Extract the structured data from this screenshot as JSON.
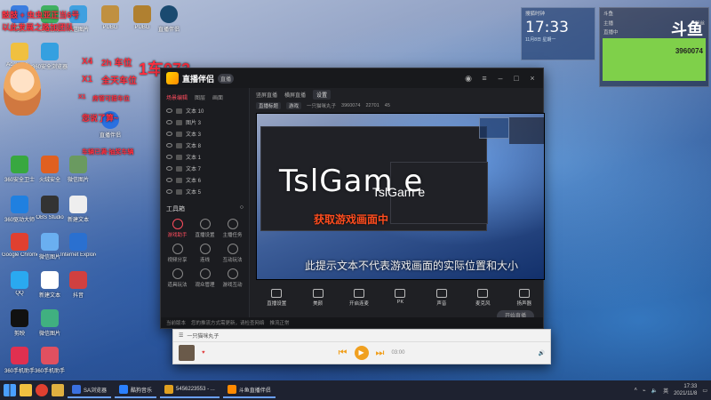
{
  "overlay": {
    "top_left_red_1": "鼓鼓 + 虫虫亚正当6号",
    "top_left_red_2": "以此发展之路加团队",
    "car_labels": [
      "X4",
      "2h 车位",
      "X1",
      "全天车位",
      "X1",
      "房管可接车位"
    ],
    "car_big": "1车073",
    "queue_msg": "您说了算~",
    "note": "车辆已满·抽奖车辆"
  },
  "desktop_icons": [
    {
      "label": "网络",
      "color": "#3b7de0"
    },
    {
      "label": "QQ",
      "color": "#2aa9f0"
    },
    {
      "label": "Administr...",
      "color": "#f0c040"
    },
    {
      "label": "电脑管家",
      "color": "#40b060"
    },
    {
      "label": "360安全卫士",
      "color": "#38a840"
    },
    {
      "label": "火绒安全",
      "color": "#e06020"
    },
    {
      "label": "360安全浏览器",
      "color": "#35a0e0"
    },
    {
      "label": "Google Chrome",
      "color": "#e04030"
    },
    {
      "label": "360驱动大师",
      "color": "#2080e0"
    },
    {
      "label": "Internet Explorer",
      "color": "#2a70d0"
    },
    {
      "label": "OBS Studio",
      "color": "#333333"
    },
    {
      "label": "剪映",
      "color": "#111111"
    },
    {
      "label": "360手机助手",
      "color": "#e03050"
    },
    {
      "label": "微信图片",
      "color": "#6a9a60"
    },
    {
      "label": "新建文本",
      "color": "#ffffff"
    },
    {
      "label": "PUBG",
      "color": "#c09040"
    },
    {
      "label": "抖音",
      "color": "#1a1a1a"
    },
    {
      "label": "直播伴侣",
      "color": "#ff9a20"
    }
  ],
  "app": {
    "name": "直播伴侣",
    "version_badge": "直播",
    "left_tabs": [
      "场景编辑",
      "图层",
      "画面"
    ],
    "sources": [
      "文本 10",
      "图片 3",
      "文本 3",
      "文本 8",
      "文本 1",
      "文本 7",
      "文本 6",
      "文本 5",
      "文本 4"
    ],
    "tools_title": "工具箱",
    "tools": [
      "游戏助手",
      "直播设置",
      "主播任务",
      "视频分享",
      "连线",
      "互动玩法",
      "道具玩法",
      "观众管理",
      "游戏互动",
      "粉丝团",
      "礼物",
      "更多"
    ],
    "center_tabs": [
      "竖屏直播",
      "横屏直播",
      "设置"
    ],
    "info": {
      "title_tag": "直播标题",
      "category": "游戏",
      "user": "一只猫咪丸子",
      "fans": "3960074",
      "likes": "22701",
      "viewers": "45"
    },
    "preview": {
      "title_big": "TslGam e",
      "title_small": "TslGam e",
      "orange_line": "获取游戏画面中",
      "note": "此提示文本不代表游戏画面的实际位置和大小"
    },
    "controls": [
      "直播设置",
      "美颜",
      "开启连麦",
      "PK",
      "声音",
      "麦克风",
      "扬声器"
    ],
    "go_live": "开始直播",
    "status": [
      "当前版本",
      "您的推流方式需更新，请检查网络",
      "推流正常"
    ]
  },
  "player": {
    "name": "一只猫咪丸子",
    "time": "03:00",
    "play_icon": "play-icon"
  },
  "clock_widget": {
    "title": "搜狐时钟",
    "time": "17:33",
    "date": "11月8日 星期一"
  },
  "live_widget": {
    "head": "斗鱼",
    "row1_left": "主播",
    "row1_right": "粉丝",
    "row2_left": "直播中",
    "brand": "斗鱼",
    "number": "3960074"
  },
  "taskbar": {
    "apps": [
      {
        "label": "SA浏览器",
        "color": "#3a70e0"
      },
      {
        "label": "酷狗音乐",
        "color": "#2a80ff"
      },
      {
        "label": "5456223553 - ...",
        "color": "#e0a020"
      },
      {
        "label": "斗鱼直播伴侣",
        "color": "#ff8a00"
      }
    ],
    "tray_lang": "英",
    "time": "17:33",
    "date": "2021/11/8"
  }
}
